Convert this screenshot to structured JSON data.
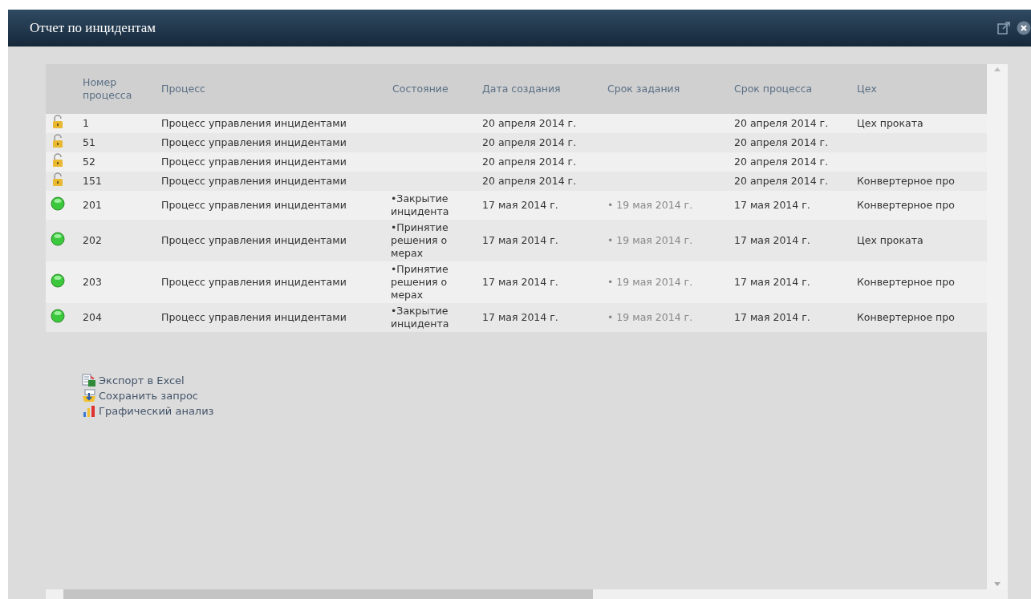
{
  "window": {
    "title": "Отчет по инцидентам"
  },
  "table": {
    "columns": [
      "Номер процесса",
      "Процесс",
      "Состояние",
      "Дата создания",
      "Срок задания",
      "Срок процесса",
      "Цех"
    ],
    "rows": [
      {
        "locked": true,
        "number": "1",
        "process": "Процесс управления инцидентами",
        "state": "",
        "created": "20 апреля 2014 г.",
        "task_due": "",
        "process_due": "20 апреля 2014 г.",
        "shop": "Цех проката"
      },
      {
        "locked": true,
        "number": "51",
        "process": "Процесс управления инцидентами",
        "state": "",
        "created": "20 апреля 2014 г.",
        "task_due": "",
        "process_due": "20 апреля 2014 г.",
        "shop": ""
      },
      {
        "locked": true,
        "number": "52",
        "process": "Процесс управления инцидентами",
        "state": "",
        "created": "20 апреля 2014 г.",
        "task_due": "",
        "process_due": "20 апреля 2014 г.",
        "shop": ""
      },
      {
        "locked": true,
        "number": "151",
        "process": "Процесс управления инцидентами",
        "state": "",
        "created": "20 апреля 2014 г.",
        "task_due": "",
        "process_due": "20 апреля 2014 г.",
        "shop": "Конвертерное про"
      },
      {
        "locked": false,
        "number": "201",
        "process": "Процесс управления инцидентами",
        "state": "•Закрытие инцидента",
        "created": "17 мая 2014 г.",
        "task_due": "• 19 мая 2014 г.",
        "process_due": "17 мая 2014 г.",
        "shop": "Конвертерное про"
      },
      {
        "locked": false,
        "number": "202",
        "process": "Процесс управления инцидентами",
        "state": "•Принятие решения о мерах",
        "created": "17 мая 2014 г.",
        "task_due": "• 19 мая 2014 г.",
        "process_due": "17 мая 2014 г.",
        "shop": "Цех проката"
      },
      {
        "locked": false,
        "number": "203",
        "process": "Процесс управления инцидентами",
        "state": "•Принятие решения о мерах",
        "created": "17 мая 2014 г.",
        "task_due": "• 19 мая 2014 г.",
        "process_due": "17 мая 2014 г.",
        "shop": "Конвертерное про"
      },
      {
        "locked": false,
        "number": "204",
        "process": "Процесс управления инцидентами",
        "state": "•Закрытие инцидента",
        "created": "17 мая 2014 г.",
        "task_due": "• 19 мая 2014 г.",
        "process_due": "17 мая 2014 г.",
        "shop": "Конвертерное про"
      }
    ]
  },
  "actions": [
    {
      "kind": "excel",
      "label": "Экспорт в Excel"
    },
    {
      "kind": "save",
      "label": "Сохранить запрос"
    },
    {
      "kind": "chart",
      "label": "Графический анализ"
    }
  ]
}
